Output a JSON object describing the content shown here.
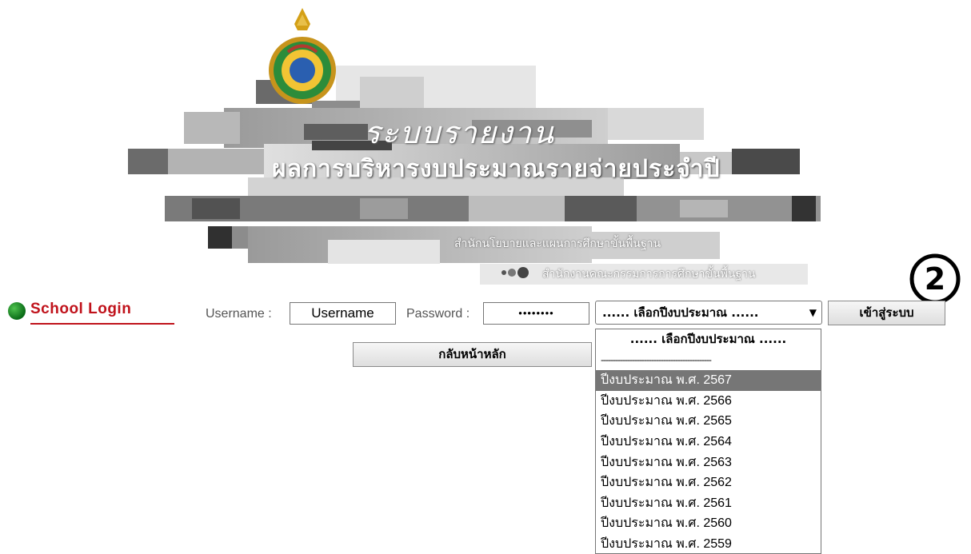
{
  "banner": {
    "title_line1": "ระบบรายงาน",
    "title_line2": "ผลการบริหารงบประมาณรายจ่ายประจำปี",
    "subtitle1": "สำนักนโยบายและแผนการศึกษาขั้นพื้นฐาน",
    "subtitle2": "สำนักงานคณะกรรมการการศึกษาขั้นพื้นฐาน"
  },
  "step_badge": "②",
  "login": {
    "heading": "School Login",
    "username_label": "Username :",
    "username_value": "Username",
    "password_label": "Password :",
    "password_value": "••••••••",
    "year_select_value": "...... เลือกปีงบประมาณ ......",
    "submit_label": "เข้าสู่ระบบ",
    "back_label": "กลับหน้าหลัก"
  },
  "dropdown": {
    "options": [
      "...... เลือกปีงบประมาณ ......",
      "----------------------------------------------",
      "ปีงบประมาณ พ.ศ. 2567",
      "ปีงบประมาณ พ.ศ. 2566",
      "ปีงบประมาณ พ.ศ. 2565",
      "ปีงบประมาณ พ.ศ. 2564",
      "ปีงบประมาณ พ.ศ. 2563",
      "ปีงบประมาณ พ.ศ. 2562",
      "ปีงบประมาณ พ.ศ. 2561",
      "ปีงบประมาณ พ.ศ. 2560",
      "ปีงบประมาณ พ.ศ. 2559"
    ],
    "highlighted": "ปีงบประมาณ พ.ศ. 2567"
  },
  "icons": {
    "emblem": "obec-emblem-icon",
    "step": "step-2-badge-icon",
    "login_dot": "green-dot-icon",
    "chevron": "chevron-down-icon"
  }
}
